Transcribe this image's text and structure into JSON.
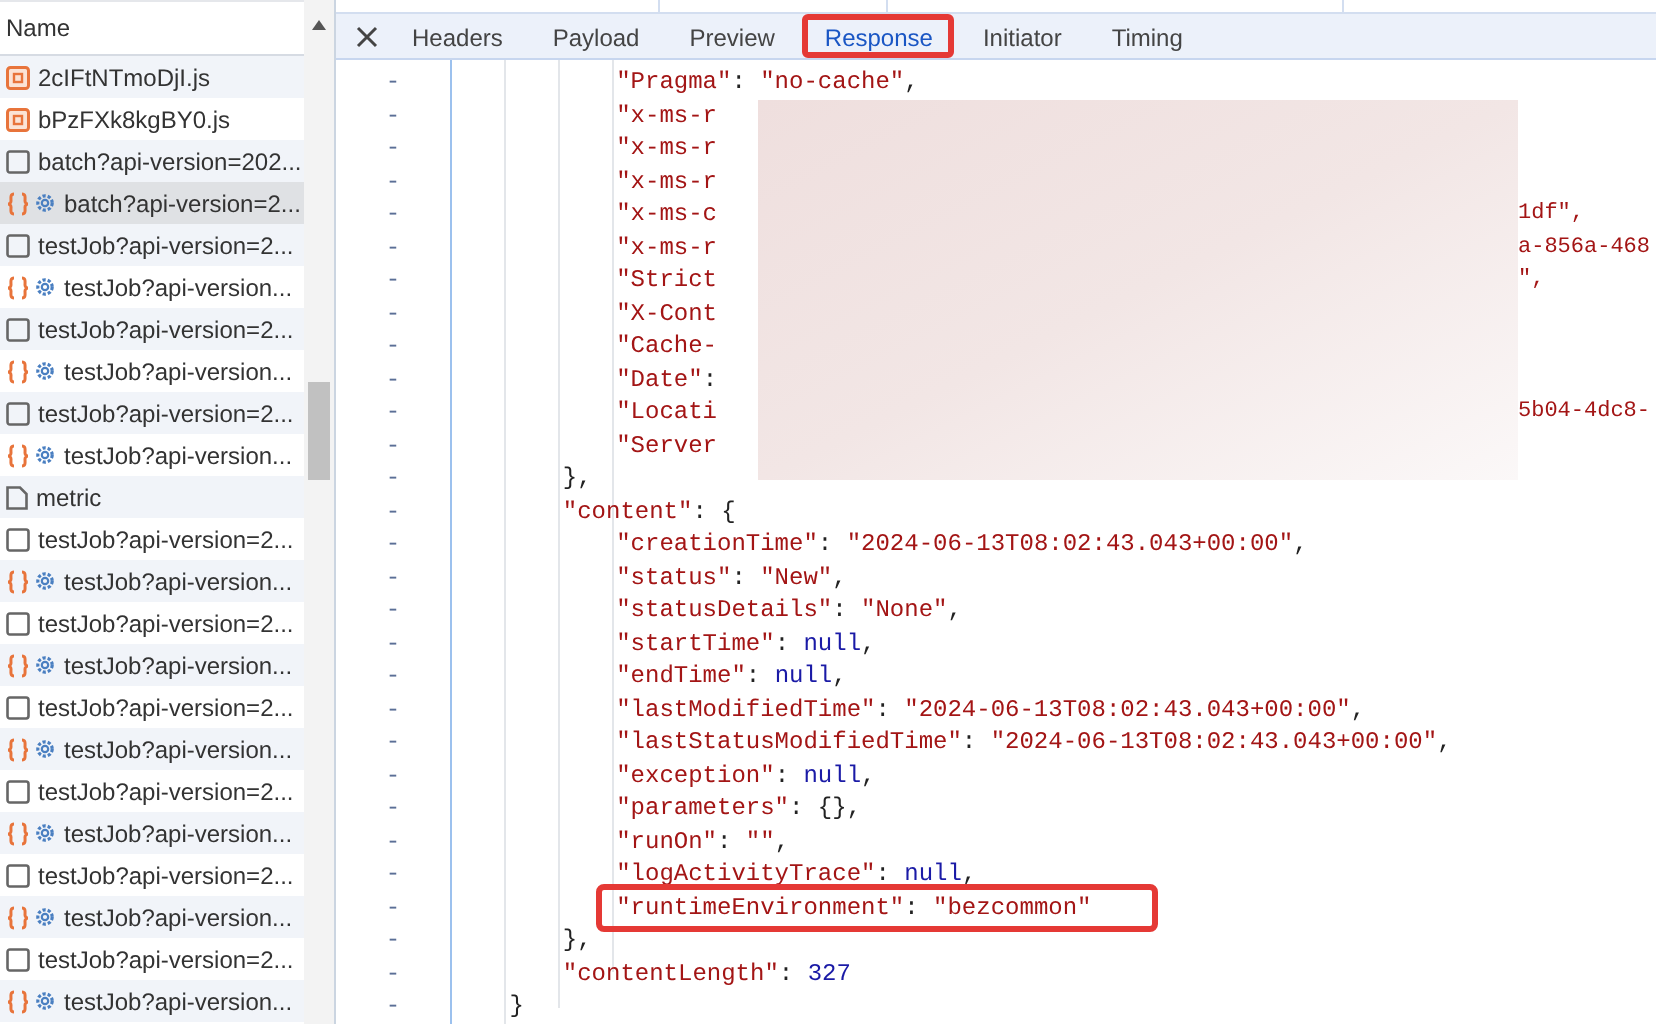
{
  "requests": {
    "header": "Name",
    "rows": [
      {
        "kind": "script",
        "name": "2cIFtNTmoDjI.js",
        "selected": false
      },
      {
        "kind": "script",
        "name": "bPzFXk8kgBY0.js",
        "selected": false
      },
      {
        "kind": "document",
        "name": "batch?api-version=202...",
        "selected": false
      },
      {
        "kind": "fetch",
        "name": "batch?api-version=2...",
        "selected": true
      },
      {
        "kind": "document",
        "name": "testJob?api-version=2...",
        "selected": false
      },
      {
        "kind": "fetch",
        "name": "testJob?api-version...",
        "selected": false
      },
      {
        "kind": "document",
        "name": "testJob?api-version=2...",
        "selected": false
      },
      {
        "kind": "fetch",
        "name": "testJob?api-version...",
        "selected": false
      },
      {
        "kind": "document",
        "name": "testJob?api-version=2...",
        "selected": false
      },
      {
        "kind": "fetch",
        "name": "testJob?api-version...",
        "selected": false
      },
      {
        "kind": "file",
        "name": "metric",
        "selected": false
      },
      {
        "kind": "document",
        "name": "testJob?api-version=2...",
        "selected": false
      },
      {
        "kind": "fetch",
        "name": "testJob?api-version...",
        "selected": false
      },
      {
        "kind": "document",
        "name": "testJob?api-version=2...",
        "selected": false
      },
      {
        "kind": "fetch",
        "name": "testJob?api-version...",
        "selected": false
      },
      {
        "kind": "document",
        "name": "testJob?api-version=2...",
        "selected": false
      },
      {
        "kind": "fetch",
        "name": "testJob?api-version...",
        "selected": false
      },
      {
        "kind": "document",
        "name": "testJob?api-version=2...",
        "selected": false
      },
      {
        "kind": "fetch",
        "name": "testJob?api-version...",
        "selected": false
      },
      {
        "kind": "document",
        "name": "testJob?api-version=2...",
        "selected": false
      },
      {
        "kind": "fetch",
        "name": "testJob?api-version...",
        "selected": false
      },
      {
        "kind": "document",
        "name": "testJob?api-version=2...",
        "selected": false
      },
      {
        "kind": "fetch",
        "name": "testJob?api-version...",
        "selected": false
      }
    ]
  },
  "tabs": [
    {
      "label": "Headers",
      "selected": false,
      "highlighted": false
    },
    {
      "label": "Payload",
      "selected": false,
      "highlighted": false
    },
    {
      "label": "Preview",
      "selected": false,
      "highlighted": false
    },
    {
      "label": "Response",
      "selected": true,
      "highlighted": true
    },
    {
      "label": "Initiator",
      "selected": false,
      "highlighted": false
    },
    {
      "label": "Timing",
      "selected": false,
      "highlighted": false
    }
  ],
  "response": {
    "redacted": true,
    "blocks": [
      {
        "close": {
          "gutter": "-",
          "segments": [
            {
              "kind": "punct",
              "text": "}"
            }
          ]
        },
        "children": [
          {
            "close": {
              "gutter": "-",
              "segments": [
                {
                  "kind": "punct",
                  "text": "},"
                }
              ]
            },
            "children": [
              {
                "gutter": "-",
                "segments": [
                  {
                    "kind": "key",
                    "text": "\"Pragma\""
                  },
                  {
                    "kind": "punct",
                    "text": ": "
                  },
                  {
                    "kind": "string",
                    "text": "\"no-cache\""
                  },
                  {
                    "kind": "punct",
                    "text": ","
                  }
                ]
              },
              {
                "gutter": "-",
                "segments": [
                  {
                    "kind": "key",
                    "text": "\"x-ms-r"
                  }
                ]
              },
              {
                "gutter": "-",
                "segments": [
                  {
                    "kind": "key",
                    "text": "\"x-ms-r"
                  }
                ]
              },
              {
                "gutter": "-",
                "segments": [
                  {
                    "kind": "key",
                    "text": "\"x-ms-r"
                  }
                ]
              },
              {
                "gutter": "-",
                "segments": [
                  {
                    "kind": "key",
                    "text": "\"x-ms-c"
                  }
                ],
                "tail": "1df\","
              },
              {
                "gutter": "-",
                "segments": [
                  {
                    "kind": "key",
                    "text": "\"x-ms-r"
                  }
                ],
                "tail": "a-856a-468"
              },
              {
                "gutter": "-",
                "segments": [
                  {
                    "kind": "key",
                    "text": "\"Strict"
                  }
                ],
                "tail": "\","
              },
              {
                "gutter": "-",
                "segments": [
                  {
                    "kind": "key",
                    "text": "\"X-Cont"
                  }
                ]
              },
              {
                "gutter": "-",
                "segments": [
                  {
                    "kind": "key",
                    "text": "\"Cache-"
                  }
                ]
              },
              {
                "gutter": "-",
                "segments": [
                  {
                    "kind": "key",
                    "text": "\"Date\""
                  },
                  {
                    "kind": "punct",
                    "text": ":"
                  }
                ]
              },
              {
                "gutter": "-",
                "segments": [
                  {
                    "kind": "key",
                    "text": "\"Locati"
                  }
                ],
                "tail": "5b04-4dc8-"
              },
              {
                "gutter": "-",
                "segments": [
                  {
                    "kind": "key",
                    "text": "\"Server"
                  }
                ]
              }
            ]
          },
          {
            "gutter": "-",
            "segments": [
              {
                "kind": "key",
                "text": "\"content\""
              },
              {
                "kind": "punct",
                "text": ": {"
              }
            ],
            "close": {
              "gutter": "-",
              "segments": [
                {
                  "kind": "punct",
                  "text": "},"
                }
              ]
            },
            "children": [
              {
                "gutter": "-",
                "segments": [
                  {
                    "kind": "key",
                    "text": "\"creationTime\""
                  },
                  {
                    "kind": "punct",
                    "text": ": "
                  },
                  {
                    "kind": "string",
                    "text": "\"2024-06-13T08:02:43.043+00:00\""
                  },
                  {
                    "kind": "punct",
                    "text": ","
                  }
                ]
              },
              {
                "gutter": "-",
                "segments": [
                  {
                    "kind": "key",
                    "text": "\"status\""
                  },
                  {
                    "kind": "punct",
                    "text": ": "
                  },
                  {
                    "kind": "string",
                    "text": "\"New\""
                  },
                  {
                    "kind": "punct",
                    "text": ","
                  }
                ]
              },
              {
                "gutter": "-",
                "segments": [
                  {
                    "kind": "key",
                    "text": "\"statusDetails\""
                  },
                  {
                    "kind": "punct",
                    "text": ": "
                  },
                  {
                    "kind": "string",
                    "text": "\"None\""
                  },
                  {
                    "kind": "punct",
                    "text": ","
                  }
                ]
              },
              {
                "gutter": "-",
                "segments": [
                  {
                    "kind": "key",
                    "text": "\"startTime\""
                  },
                  {
                    "kind": "punct",
                    "text": ": "
                  },
                  {
                    "kind": "literal",
                    "text": "null"
                  },
                  {
                    "kind": "punct",
                    "text": ","
                  }
                ]
              },
              {
                "gutter": "-",
                "segments": [
                  {
                    "kind": "key",
                    "text": "\"endTime\""
                  },
                  {
                    "kind": "punct",
                    "text": ": "
                  },
                  {
                    "kind": "literal",
                    "text": "null"
                  },
                  {
                    "kind": "punct",
                    "text": ","
                  }
                ]
              },
              {
                "gutter": "-",
                "segments": [
                  {
                    "kind": "key",
                    "text": "\"lastModifiedTime\""
                  },
                  {
                    "kind": "punct",
                    "text": ": "
                  },
                  {
                    "kind": "string",
                    "text": "\"2024-06-13T08:02:43.043+00:00\""
                  },
                  {
                    "kind": "punct",
                    "text": ","
                  }
                ]
              },
              {
                "gutter": "-",
                "segments": [
                  {
                    "kind": "key",
                    "text": "\"lastStatusModifiedTime\""
                  },
                  {
                    "kind": "punct",
                    "text": ": "
                  },
                  {
                    "kind": "string",
                    "text": "\"2024-06-13T08:02:43.043+00:00\""
                  },
                  {
                    "kind": "punct",
                    "text": ","
                  }
                ]
              },
              {
                "gutter": "-",
                "segments": [
                  {
                    "kind": "key",
                    "text": "\"exception\""
                  },
                  {
                    "kind": "punct",
                    "text": ": "
                  },
                  {
                    "kind": "literal",
                    "text": "null"
                  },
                  {
                    "kind": "punct",
                    "text": ","
                  }
                ]
              },
              {
                "gutter": "-",
                "segments": [
                  {
                    "kind": "key",
                    "text": "\"parameters\""
                  },
                  {
                    "kind": "punct",
                    "text": ": {},"
                  }
                ]
              },
              {
                "gutter": "-",
                "segments": [
                  {
                    "kind": "key",
                    "text": "\"runOn\""
                  },
                  {
                    "kind": "punct",
                    "text": ": "
                  },
                  {
                    "kind": "string",
                    "text": "\"\""
                  },
                  {
                    "kind": "punct",
                    "text": ","
                  }
                ]
              },
              {
                "gutter": "-",
                "segments": [
                  {
                    "kind": "key",
                    "text": "\"logActivityTrace\""
                  },
                  {
                    "kind": "punct",
                    "text": ": "
                  },
                  {
                    "kind": "literal",
                    "text": "null"
                  },
                  {
                    "kind": "punct",
                    "text": ","
                  }
                ]
              },
              {
                "gutter": "-",
                "highlighted": true,
                "segments": [
                  {
                    "kind": "key",
                    "text": "\"runtimeEnvironment\""
                  },
                  {
                    "kind": "punct",
                    "text": ": "
                  },
                  {
                    "kind": "string",
                    "text": "\"bezcommon\""
                  }
                ]
              }
            ]
          },
          {
            "gutter": "-",
            "segments": [
              {
                "kind": "key",
                "text": "\"contentLength\""
              },
              {
                "kind": "punct",
                "text": ": "
              },
              {
                "kind": "literal",
                "text": "327"
              }
            ]
          }
        ]
      }
    ]
  }
}
